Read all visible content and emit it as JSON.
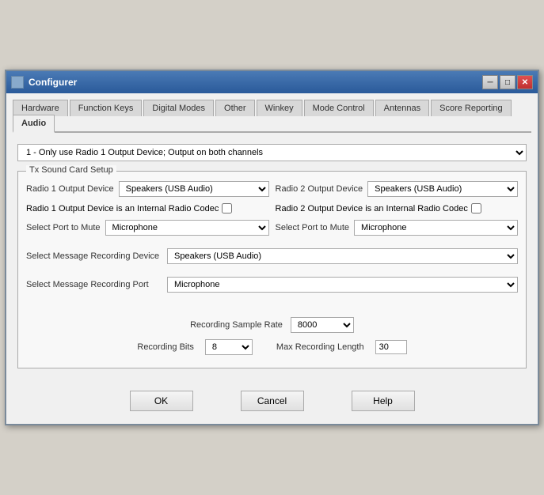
{
  "window": {
    "title": "Configurer",
    "close_btn": "✕",
    "min_btn": "─",
    "max_btn": "□"
  },
  "tabs": [
    {
      "label": "Hardware",
      "active": false
    },
    {
      "label": "Function Keys",
      "active": false
    },
    {
      "label": "Digital Modes",
      "active": false
    },
    {
      "label": "Other",
      "active": false
    },
    {
      "label": "Winkey",
      "active": false
    },
    {
      "label": "Mode Control",
      "active": false
    },
    {
      "label": "Antennas",
      "active": false
    },
    {
      "label": "Score Reporting",
      "active": false
    },
    {
      "label": "Audio",
      "active": true
    }
  ],
  "top_dropdown": {
    "value": "1 - Only use Radio 1 Output Device; Output on both channels",
    "options": [
      "1 - Only use Radio 1 Output Device; Output on both channels"
    ]
  },
  "group": {
    "label": "Tx Sound Card Setup",
    "radio1_output_label": "Radio 1 Output Device",
    "radio2_output_label": "Radio 2 Output Device",
    "radio1_output_value": "Speakers (USB Audio)",
    "radio2_output_value": "Speakers (USB Audio)",
    "radio1_codec_label": "Radio 1 Output Device is an Internal Radio Codec",
    "radio2_codec_label": "Radio 2 Output Device is an Internal Radio Codec",
    "select_mute_label1": "Select Port to Mute",
    "select_mute_label2": "Select Port to Mute",
    "mute1_value": "Microphone",
    "mute2_value": "Microphone",
    "message_recording_device_label": "Select Message Recording Device",
    "message_recording_device_value": "Speakers (USB Audio)",
    "message_recording_port_label": "Select Message Recording Port",
    "message_recording_port_value": "Microphone",
    "recording_sample_rate_label": "Recording Sample Rate",
    "recording_sample_rate_value": "8000",
    "recording_bits_label": "Recording Bits",
    "recording_bits_value": "8",
    "max_recording_length_label": "Max Recording Length",
    "max_recording_length_value": "30"
  },
  "footer": {
    "ok_label": "OK",
    "cancel_label": "Cancel",
    "help_label": "Help"
  }
}
